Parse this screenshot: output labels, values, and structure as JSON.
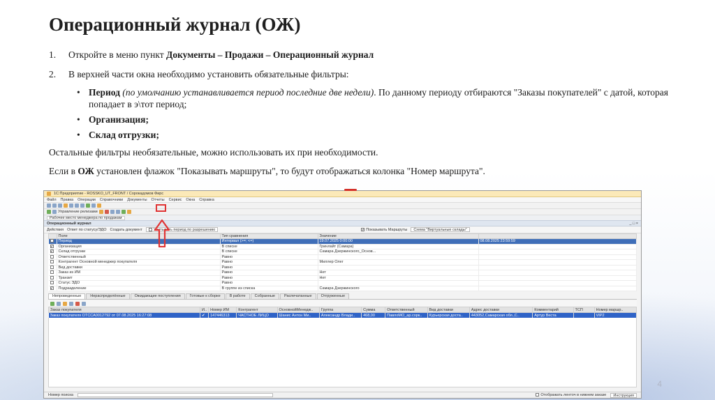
{
  "slide": {
    "title": "Операционный журнал (ОЖ)",
    "page_number": "4",
    "items": [
      {
        "num": "1.",
        "pre": "Откройте в меню пункт ",
        "bold": "Документы – Продажи – Операционный журнал"
      },
      {
        "num": "2.",
        "text": "В верхней части окна необходимо установить обязательные фильтры:"
      }
    ],
    "bullets": [
      {
        "bold": "Период",
        "italic": " (по умолчанию устанавливается период последние две недели)",
        "rest": ". По данному периоду отбираются \"Заказы покупателей\" с датой, которая попадает в э\\тот период;"
      },
      {
        "bold": "Организация;"
      },
      {
        "bold": "Склад отгрузки;"
      }
    ],
    "para1": "Остальные фильтры необязательные, можно использовать их при необходимости.",
    "para2": {
      "pre": "Если в ",
      "bold": "ОЖ",
      "rest": " установлен флажок \"Показывать маршруты\", то будут отображаться колонка \"Номер маршрута\"."
    }
  },
  "screenshot": {
    "window_title": "1С:Предприятие - ROSSKO_UT_FRONT / Сорокадомов Фирс",
    "menu": [
      "Файл",
      "Правка",
      "Операции",
      "Справочники",
      "Документы",
      "Отчеты",
      "Сервис",
      "Окна",
      "Справка"
    ],
    "toolbar_label": "Управление релизами",
    "panel_label": "Рабочее место менеджера по продажам",
    "doc_title": "Операционный журнал",
    "cmd": {
      "actions": "Действия",
      "set_status": "Ответ по статусу/ЭДО",
      "create": "Создать документ",
      "route_flag": "Учитывать период по разрешению",
      "show_routes": "Показывать Маршруты",
      "virtual_cells": "Схема \"Виртуальные склады\""
    },
    "filter_headers": [
      "Поле",
      "Тип сравнения",
      "Значение",
      ""
    ],
    "filters": [
      {
        "checked": true,
        "field": "Период",
        "cmp": "Интервал (>=; <=)",
        "value": "19.07.2025 0:00:00",
        "value2": "08.08.2025 23:59:59",
        "selected": true
      },
      {
        "checked": true,
        "field": "Организация",
        "cmp": "В списке",
        "value": "Гринлайт (Самара)",
        "value2": ""
      },
      {
        "checked": true,
        "field": "Склад отгрузки",
        "cmp": "В списке",
        "value": "Самара Дзержинского_Основ...",
        "value2": ""
      },
      {
        "checked": false,
        "field": "Ответственный",
        "cmp": "Равно",
        "value": "",
        "value2": ""
      },
      {
        "checked": false,
        "field": "Контрагент Основной менеджер покупателя",
        "cmp": "Равно",
        "value": "Миллер Олег",
        "value2": ""
      },
      {
        "checked": false,
        "field": "Вид доставки",
        "cmp": "Равно",
        "value": "",
        "value2": ""
      },
      {
        "checked": false,
        "field": "Заказ из ИМ",
        "cmp": "Равно",
        "value": "Нет",
        "value2": ""
      },
      {
        "checked": false,
        "field": "Транзит",
        "cmp": "Равно",
        "value": "Нет",
        "value2": ""
      },
      {
        "checked": false,
        "field": "Статус ЭДО",
        "cmp": "Равно",
        "value": "",
        "value2": ""
      },
      {
        "checked": true,
        "field": "Подразделение",
        "cmp": "В группе из списка",
        "value": "Самара Дзержинского",
        "value2": ""
      }
    ],
    "tabs": [
      "Непроведенные",
      "Нераспределённые",
      "Ожидающие поступления",
      "Готовые к сборке",
      "В работе",
      "Собранные",
      "Распечатанные",
      "Отгруженные"
    ],
    "list_headers": [
      "Заказ покупателя",
      "И..",
      "Номер ИМ",
      "Контрагент",
      "ОсновнойМенедж..",
      "Группа",
      "Сумма",
      "Ответственный",
      "Вид доставки",
      "Адрес доставки",
      "Комментарий",
      "ТСП",
      "Номер маршр.."
    ],
    "list_rows": [
      [
        "Заказ покупателя ОТССА0012792 от 07.08.2025 16:27:08",
        "✔",
        "147446313",
        "ЧАСТНОЕ ЛИЦО",
        "Шанис Антон Ми..",
        "Александр Влади..",
        "468,00",
        "ПавлоМО_ар.сорк..",
        "Курьерская доста..",
        "443052,Самарская обл.,С..",
        "Артур Веста",
        "",
        "VIP2"
      ]
    ],
    "status_search_label": "Номер поиска",
    "status_flag": "Отображать ленточ в нижнем заказе",
    "status_history": "Инструкция"
  }
}
